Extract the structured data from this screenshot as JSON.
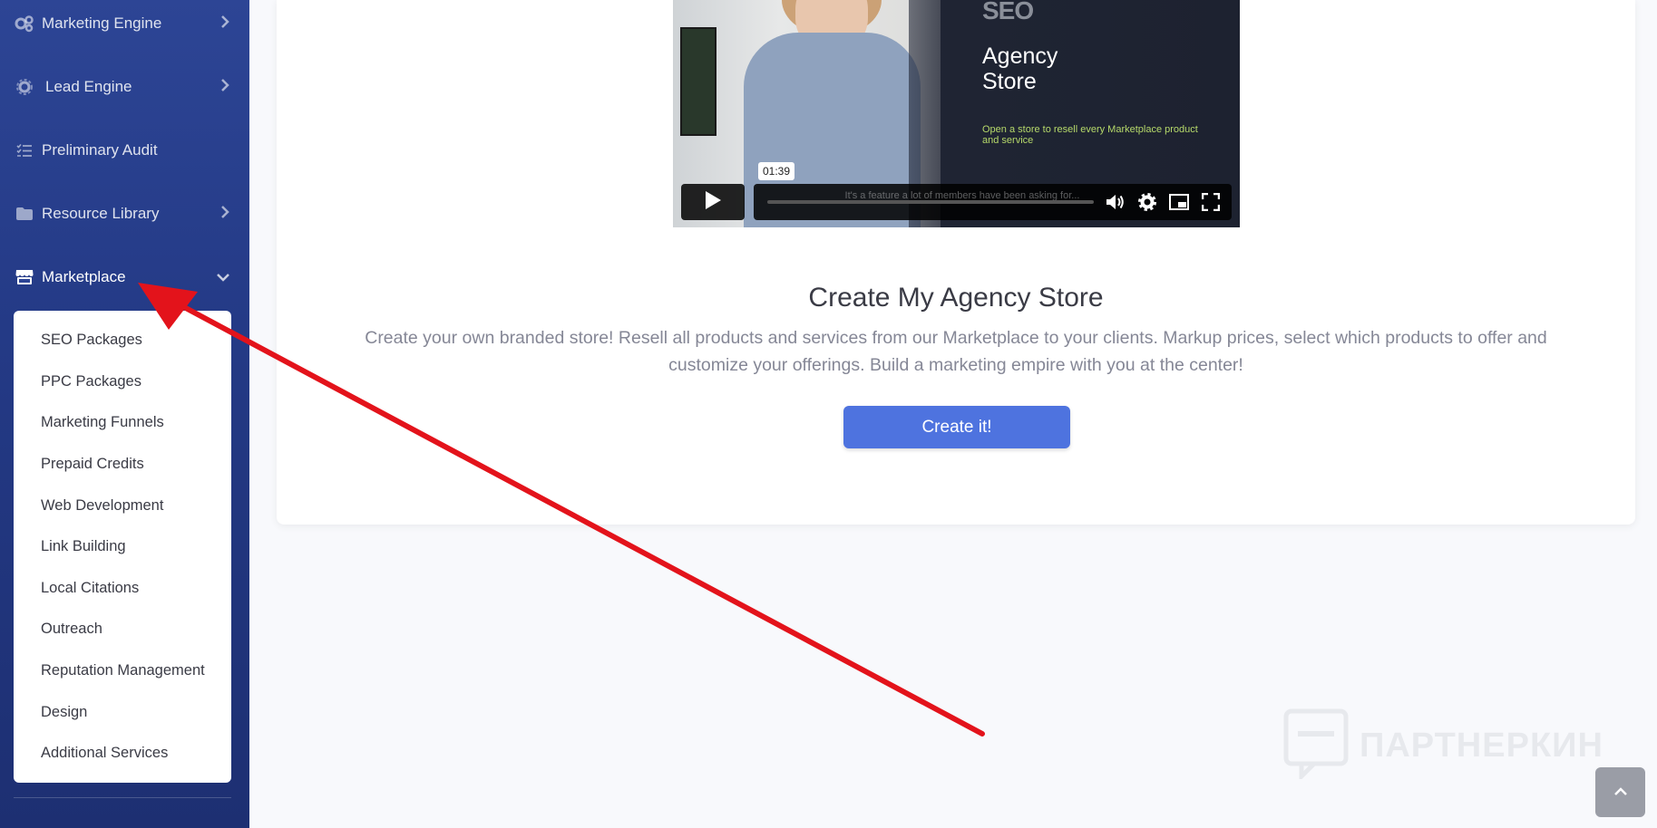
{
  "sidebar": {
    "items": [
      {
        "label": "Marketing Engine",
        "icon": "gears-icon"
      },
      {
        "label": "Lead Engine",
        "icon": "gear-icon"
      },
      {
        "label": "Preliminary Audit",
        "icon": "list-check-icon"
      },
      {
        "label": "Resource Library",
        "icon": "folder-icon"
      },
      {
        "label": "Marketplace",
        "icon": "store-icon"
      }
    ],
    "submenu": [
      "SEO Packages",
      "PPC Packages",
      "Marketing Funnels",
      "Prepaid Credits",
      "Web Development",
      "Link Building",
      "Local Citations",
      "Outreach",
      "Reputation Management",
      "Design",
      "Additional Services"
    ]
  },
  "video": {
    "logo": "SEO",
    "title_line1": "Agency",
    "title_line2": "Store",
    "subtitle": "Open a store to resell every Marketplace product and service",
    "time": "01:39",
    "caption": "It's a feature a lot of members have been asking for..."
  },
  "main": {
    "title": "Create My Agency Store",
    "description": "Create your own branded store! Resell all products and services from our Marketplace to your clients. Markup prices, select which products to offer and customize your offerings. Build a marketing empire with you at the center!",
    "button_label": "Create it!"
  },
  "watermark": "ПАРТНЕРКИН",
  "colors": {
    "sidebar": "#2d4595",
    "primary": "#4e73df",
    "annotation": "#e3131b"
  }
}
